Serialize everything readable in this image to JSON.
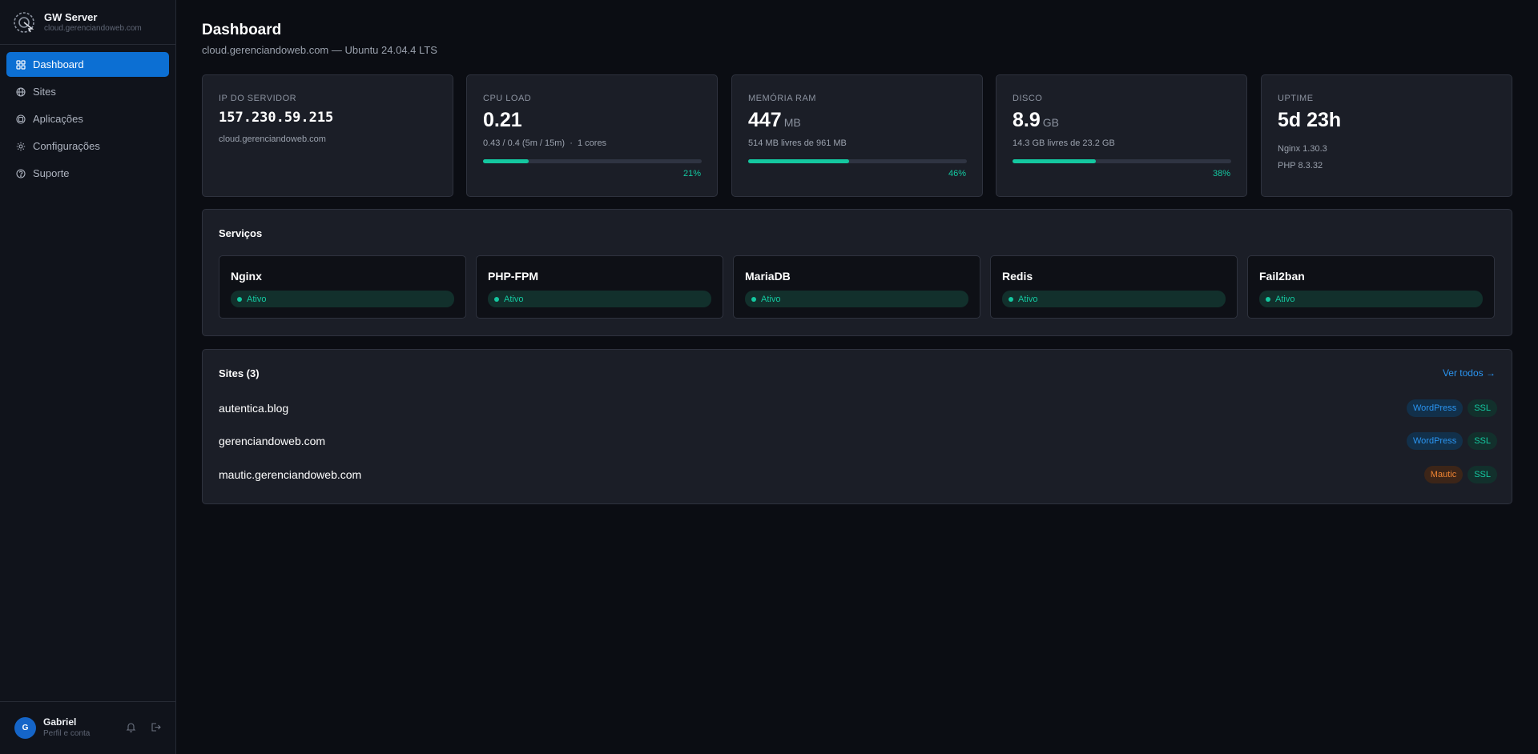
{
  "app": {
    "name": "GW Server",
    "host": "cloud.gerenciandoweb.com"
  },
  "sidebar": {
    "items": [
      {
        "label": "Dashboard",
        "icon": "grid-icon",
        "active": true
      },
      {
        "label": "Sites",
        "icon": "globe-icon",
        "active": false
      },
      {
        "label": "Aplicações",
        "icon": "box-icon",
        "active": false
      },
      {
        "label": "Configurações",
        "icon": "gear-icon",
        "active": false
      },
      {
        "label": "Suporte",
        "icon": "help-circle-icon",
        "active": false
      }
    ]
  },
  "user": {
    "initial": "G",
    "name": "Gabriel",
    "subtitle": "Perfil e conta"
  },
  "header": {
    "title": "Dashboard",
    "subtitle": "cloud.gerenciandoweb.com — Ubuntu 24.04.4 LTS"
  },
  "stats": {
    "ip": {
      "label": "IP DO SERVIDOR",
      "value": "157.230.59.215",
      "sub": "cloud.gerenciandoweb.com"
    },
    "cpu": {
      "label": "CPU LOAD",
      "value": "0.21",
      "sub": "0.43 / 0.4 (5m / 15m)  ·  1 cores",
      "percent_label": "21%",
      "percent": 21
    },
    "ram": {
      "label": "MEMÓRIA RAM",
      "value": "447",
      "unit": "MB",
      "sub": "514 MB livres de 961 MB",
      "percent_label": "46%",
      "percent": 46
    },
    "disk": {
      "label": "DISCO",
      "value": "8.9",
      "unit": "GB",
      "sub": "14.3 GB livres de 23.2 GB",
      "percent_label": "38%",
      "percent": 38
    },
    "uptime": {
      "label": "UPTIME",
      "value": "5d 23h",
      "nginx": "Nginx 1.30.3",
      "php": "PHP 8.3.32"
    }
  },
  "services": {
    "title": "Serviços",
    "items": [
      {
        "name": "Nginx",
        "status": "Ativo"
      },
      {
        "name": "PHP-FPM",
        "status": "Ativo"
      },
      {
        "name": "MariaDB",
        "status": "Ativo"
      },
      {
        "name": "Redis",
        "status": "Ativo"
      },
      {
        "name": "Fail2ban",
        "status": "Ativo"
      }
    ]
  },
  "sites": {
    "title": "Sites (3)",
    "see_all": "Ver todos →",
    "items": [
      {
        "name": "autentica.blog",
        "tag": "WordPress",
        "ssl": "SSL"
      },
      {
        "name": "gerenciandoweb.com",
        "tag": "WordPress",
        "ssl": "SSL"
      },
      {
        "name": "mautic.gerenciandoweb.com",
        "tag": "Mautic",
        "ssl": "SSL"
      }
    ]
  },
  "colors": {
    "accent": "#0c6fd3",
    "success": "#14c8a0",
    "link": "#2a94f0",
    "mautic": "#f08432",
    "background": "#0b0d13",
    "card": "#1b1e27"
  }
}
